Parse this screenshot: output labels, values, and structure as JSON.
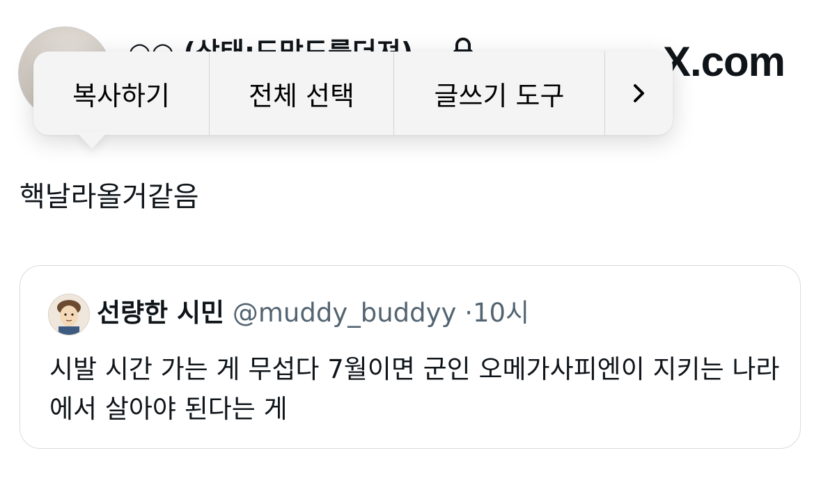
{
  "post": {
    "author_name": "○○ (상태:도망도를더져)",
    "text": "핵날라올거같음"
  },
  "brand": "X.com",
  "context_menu": {
    "items": [
      "복사하기",
      "전체 선택",
      "글쓰기 도구"
    ],
    "more_icon": "chevron-right-icon"
  },
  "quoted_post": {
    "name": "선량한 시민",
    "handle": "@muddy_buddyy",
    "separator": "·",
    "time": "10시",
    "text": "시발 시간 가는 게 무섭다 7월이면 군인 오메가사피엔이 지키는 나라에서 살아야 된다는 게"
  },
  "colors": {
    "text": "#0f1419",
    "secondary": "#536471",
    "border": "#d7dce0",
    "menu_bg": "#f4f4f5"
  }
}
